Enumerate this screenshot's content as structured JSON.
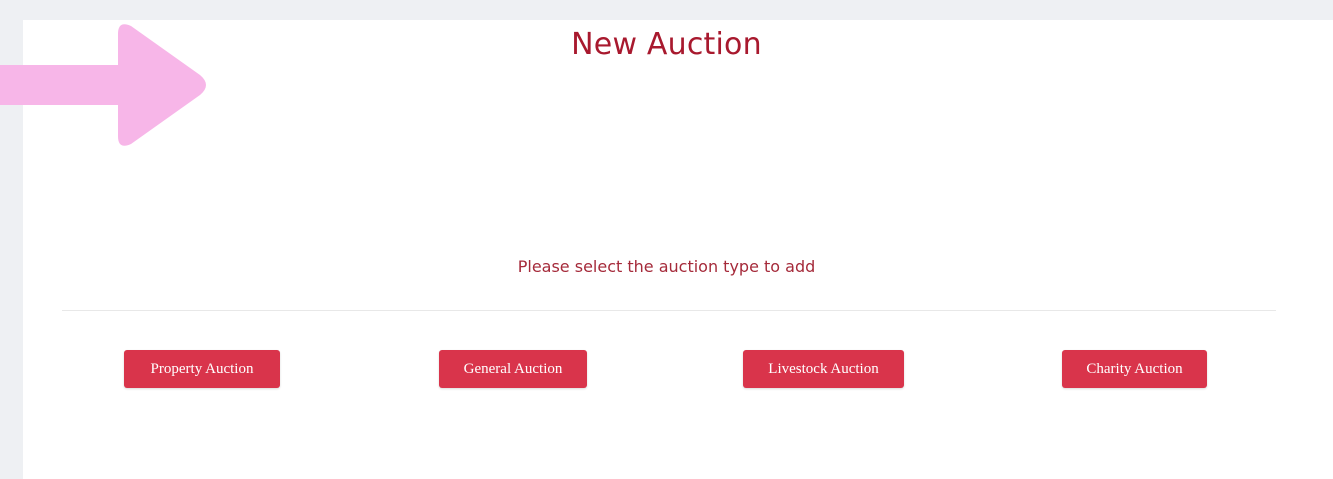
{
  "page": {
    "title": "New Auction",
    "subtitle": "Please select the auction type to add"
  },
  "auction_types": [
    {
      "label": "Property Auction"
    },
    {
      "label": "General Auction"
    },
    {
      "label": "Livestock Auction"
    },
    {
      "label": "Charity Auction"
    }
  ],
  "colors": {
    "title": "#a8192e",
    "subtitle": "#a52a3a",
    "button": "#d9344b",
    "arrow": "#f7b6e8",
    "background": "#eef0f3",
    "panel": "#ffffff"
  },
  "icons": {
    "annotation": "right-arrow-icon"
  }
}
